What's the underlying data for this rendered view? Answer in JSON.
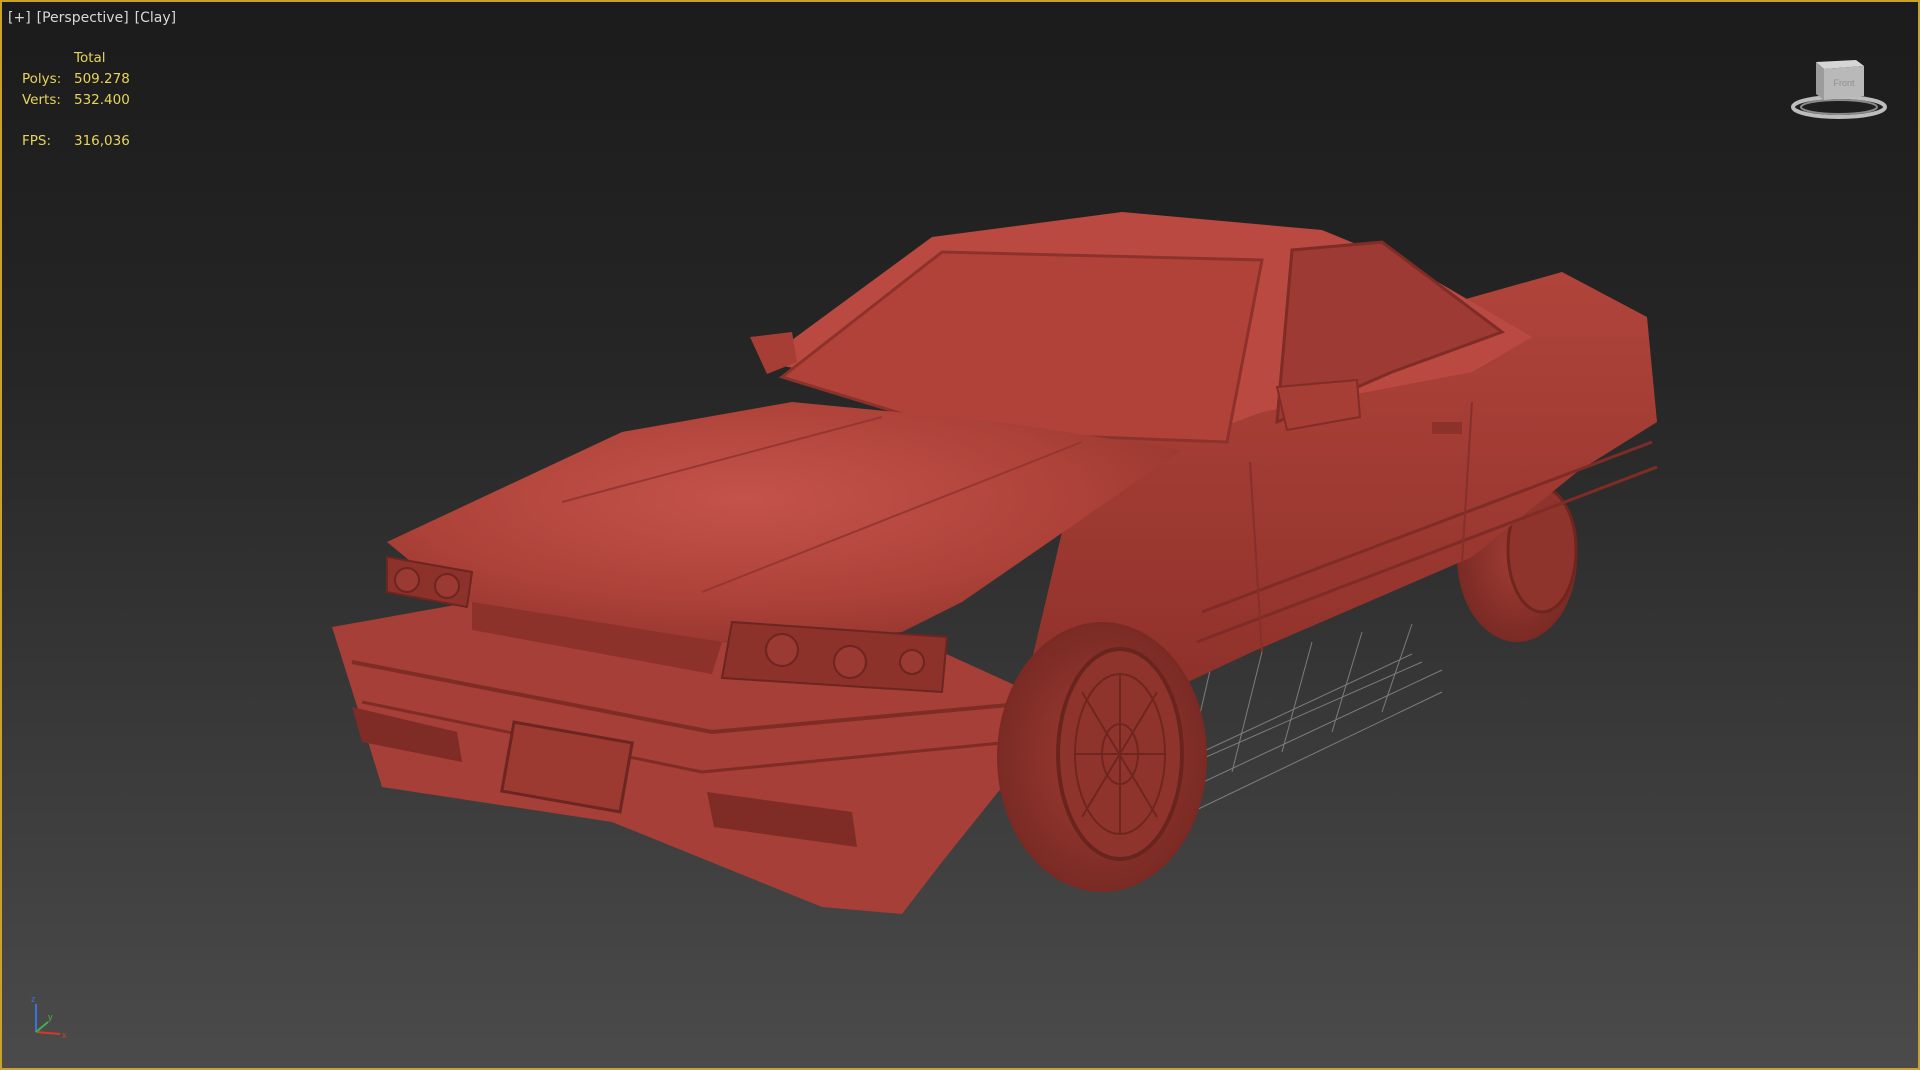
{
  "viewport": {
    "label_plus": "[+]",
    "label_view": "[Perspective]",
    "label_shading": "[Clay]"
  },
  "stats": {
    "header": "Total",
    "polys_label": "Polys:",
    "polys_value": "509.278",
    "verts_label": "Verts:",
    "verts_value": "532.400",
    "fps_label": "FPS:",
    "fps_value": "316,036"
  },
  "viewcube": {
    "face_label": "Front"
  },
  "axis": {
    "z": "z",
    "x": "x",
    "y": "y"
  },
  "colors": {
    "border": "#c9a227",
    "stats_text": "#e8d45a",
    "clay": "#b3453c"
  }
}
